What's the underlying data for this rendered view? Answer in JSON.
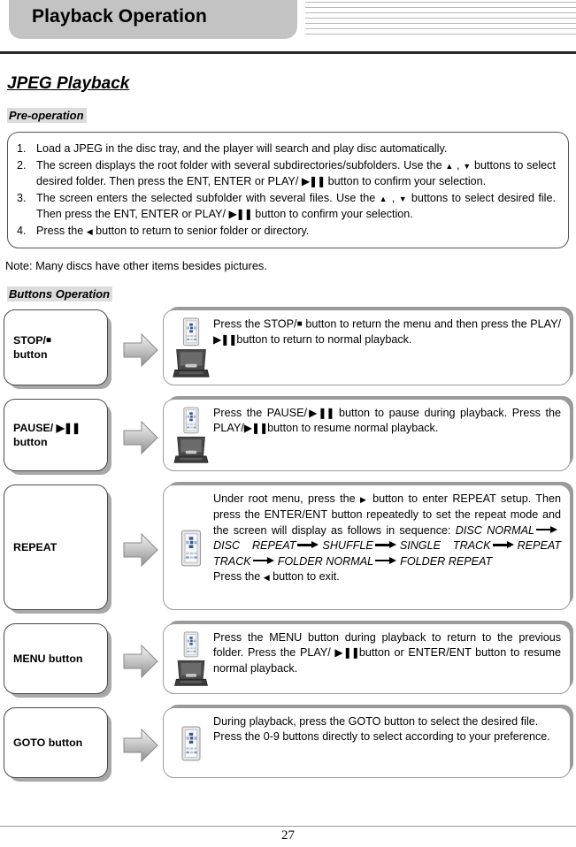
{
  "header": {
    "title": "Playback Operation",
    "decorative_line_count": 7
  },
  "section": {
    "heading": "JPEG Playback",
    "pre_operation_label": "Pre-operation",
    "buttons_operation_label": "Buttons Operation"
  },
  "pre_operation": {
    "steps": [
      {
        "num": "1.",
        "text": "Load a JPEG in the disc tray, and the player will search and play disc automatically."
      },
      {
        "num": "2.",
        "parts": [
          "The screen displays the root folder with several subdirectories/subfolders. Use the ",
          "up-arrow-icon",
          " , ",
          "down-arrow-icon",
          " buttons to select desired folder. Then press the ENT, ENTER or PLAY/ ",
          "play-pause-icon",
          " button to confirm your selection."
        ]
      },
      {
        "num": "3.",
        "parts": [
          "The screen enters the selected subfolder with several files. Use the ",
          "up-arrow-icon",
          " , ",
          "down-arrow-icon",
          " buttons to select desired file. Then press the ENT, ENTER or PLAY/ ",
          "play-pause-icon",
          " button to confirm your selection."
        ]
      },
      {
        "num": "4.",
        "parts": [
          "Press the ",
          "left-arrow-icon",
          " button to return to senior folder or directory."
        ]
      }
    ],
    "note": "Note: Many discs have other items besides pictures."
  },
  "button_rows": [
    {
      "label_line1": "STOP/",
      "label_stop_glyph": "stop-square-icon",
      "label_line2": "button",
      "device": "remote-and-player",
      "text_segments": [
        "Press the STOP/",
        "stop-square-icon",
        " button to return the menu and then press the PLAY/",
        "play-pause-icon",
        "button to return to normal playback."
      ]
    },
    {
      "label_line1": "PAUSE/",
      "label_play_glyph": "play-pause-icon",
      "label_line2": "button",
      "device": "remote-and-player",
      "text_segments": [
        "Press the PAUSE/",
        "play-pause-icon",
        " button to pause during playback. Press the PLAY/",
        "play-pause-icon",
        "button to resume normal playback."
      ]
    },
    {
      "label_line1": "REPEAT",
      "device": "remote-only",
      "paragraph_1_a": "Under root menu, press the",
      "paragraph_1_right_icon": "right-arrow-icon",
      "paragraph_1_b": "button to enter REPEAT setup. Then press the ENTER/ENT button repeatedly to set the repeat mode and the screen will display as follows in sequence:",
      "sequence": [
        "DISC NORMAL",
        "DISC REPEAT",
        "SHUFFLE",
        "SINGLE  TRACK",
        "REPEAT TRACK",
        "FOLDER NORMAL",
        "FOLDER REPEAT"
      ],
      "exit_a": "Press the",
      "exit_icon": "left-arrow-icon",
      "exit_b": "button to exit."
    },
    {
      "label_line1": "MENU button",
      "device": "remote-and-player",
      "text_segments": [
        "Press the MENU button during playback to return to the previous folder. Press the PLAY/ ",
        "play-pause-icon",
        "button or ENTER/ENT button to resume normal playback."
      ]
    },
    {
      "label_line1": "GOTO button",
      "device": "remote-only",
      "line_1": "During playback, press the GOTO button to select the desired file.",
      "line_2": "Press the 0-9 buttons directly to select according to your preference."
    }
  ],
  "footer": {
    "page_number": "27"
  },
  "colors": {
    "title_bar": "#c3c3c3",
    "highlight": "#dcdcdc",
    "rule": "#2b2b2b",
    "shadow": "#a8a8a8",
    "remote_button_blue": "#3b5b8c"
  }
}
